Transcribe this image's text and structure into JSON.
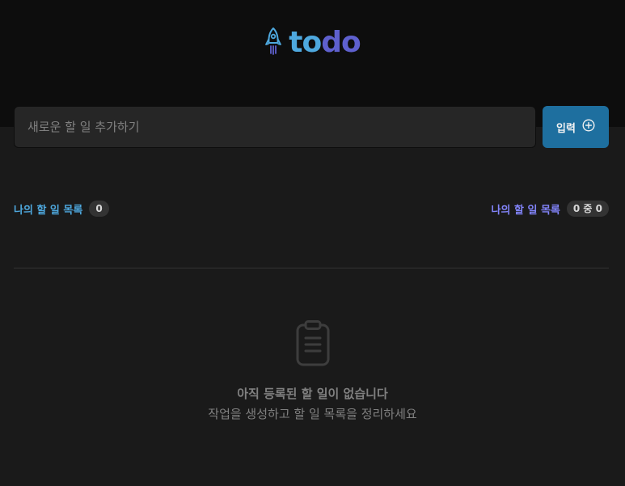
{
  "header": {
    "logo_icon": "rocket-icon",
    "logo_part1": "to",
    "logo_part2": "do",
    "colors": {
      "blue": "#4ea8de",
      "purple": "#5e60ce"
    }
  },
  "form": {
    "placeholder": "새로운 할 일 추가하기",
    "value": "",
    "button_label": "입력",
    "button_icon": "plus-circle-icon",
    "button_color": "#1e6f9f"
  },
  "counters": {
    "created_label": "나의 할 일 목록",
    "created_count": "0",
    "done_label": "나의 할 일 목록",
    "done_count": "0 중 0"
  },
  "empty": {
    "icon": "clipboard-icon",
    "title": "아직 등록된 할 일이 없습니다",
    "subtitle": "작업을 생성하고 할 일 목록을 정리하세요"
  }
}
